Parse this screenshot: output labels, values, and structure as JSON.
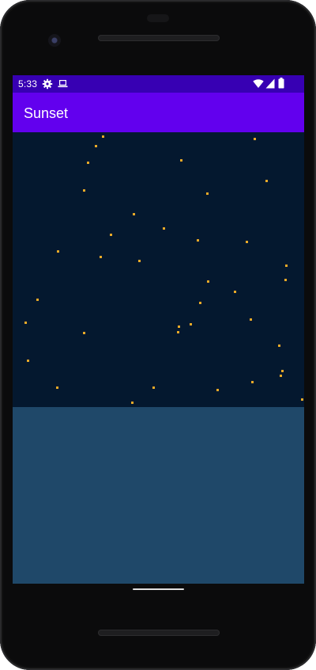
{
  "status_bar": {
    "time": "5:33",
    "left_icons": [
      "gear-icon",
      "laptop-icon"
    ],
    "right_icons": [
      "wifi-icon",
      "signal-icon",
      "battery-icon"
    ]
  },
  "app_bar": {
    "title": "Sunset"
  },
  "scene": {
    "night_sky_color": "#04182f",
    "sea_color": "#1f4869",
    "star_color": "#e8a928",
    "star_count": 39
  },
  "colors": {
    "status_bar": "#3700b3",
    "app_bar": "#6200ee",
    "app_bar_text": "#ffffff",
    "phone_frame": "#0b0b0c"
  }
}
